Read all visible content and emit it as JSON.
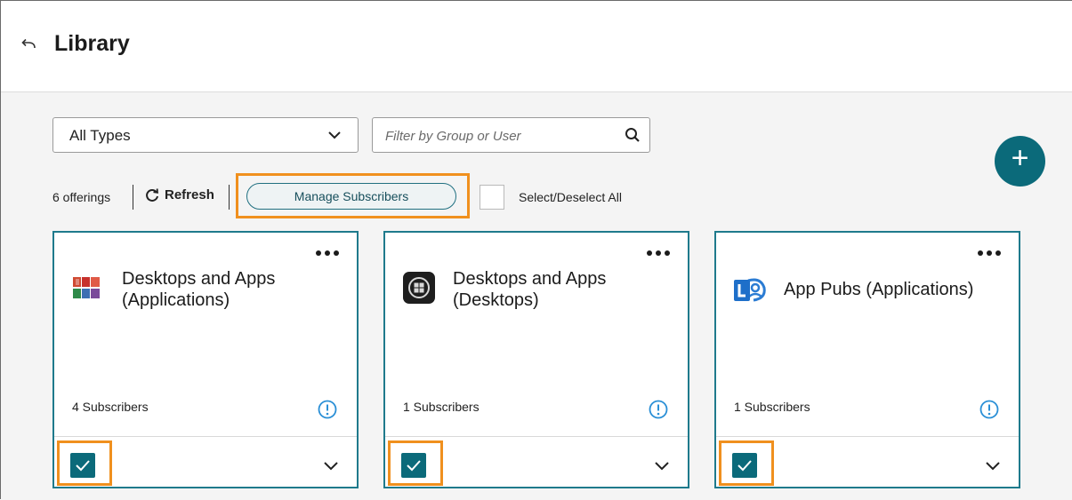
{
  "header": {
    "title": "Library",
    "back_icon": "back-arrow-icon"
  },
  "filters": {
    "type_select": {
      "selected": "All Types",
      "icon": "chevron-down-icon"
    },
    "search": {
      "placeholder": "Filter by Group or User",
      "value": "",
      "icon": "search-icon"
    }
  },
  "add_button": {
    "label": "+",
    "color": "#0b6a7a"
  },
  "toolbar": {
    "offerings_count": "6 offerings",
    "refresh_label": "Refresh",
    "refresh_icon": "refresh-icon",
    "manage_subscribers_label": "Manage Subscribers",
    "select_all_label": "Select/Deselect All"
  },
  "cards": [
    {
      "name": "Desktops and Apps (Applications)",
      "icon": "office-apps-icon",
      "subscribers": "4 Subscribers",
      "checked": true
    },
    {
      "name": "Desktops and Apps (Desktops)",
      "icon": "windows-desktop-icon",
      "subscribers": "1 Subscribers",
      "checked": true
    },
    {
      "name": "App Pubs (Applications)",
      "icon": "lync-app-icon",
      "subscribers": "1 Subscribers",
      "checked": true
    }
  ],
  "colors": {
    "accent": "#0b6a7a",
    "card_border": "#1f7a8c",
    "highlight": "#f0901e",
    "info": "#2a8fd6"
  }
}
